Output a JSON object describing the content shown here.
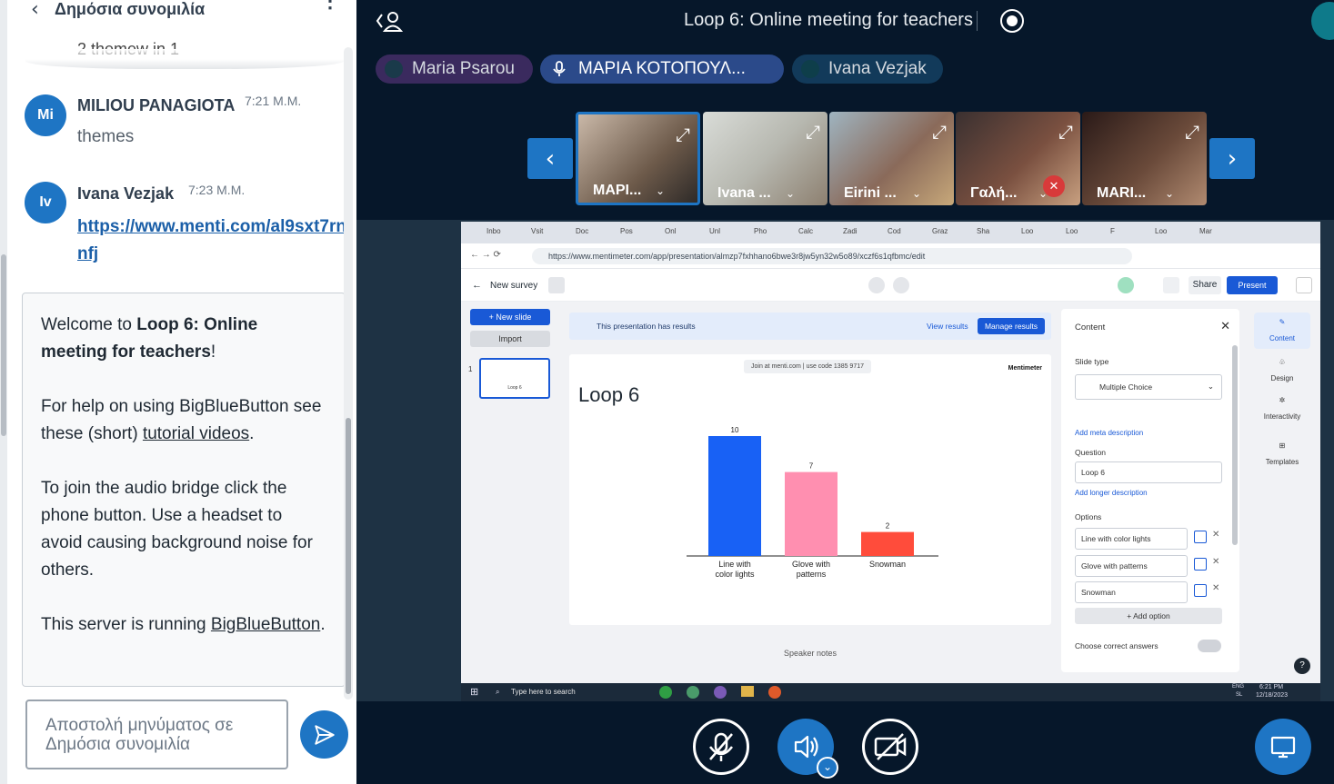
{
  "chat": {
    "header_title": "Δημόσια συνομιλία",
    "prev_text": "2 themew in 1",
    "messages": [
      {
        "initials": "Mi",
        "name": "MILIOU PANAGIOTA",
        "time": "7:21 Μ.Μ.",
        "text": "themes"
      },
      {
        "initials": "Iv",
        "name": "Ivana Vezjak",
        "time": "7:23 Μ.Μ.",
        "link": "https://www.menti.com/al9sxt7rnnfj"
      }
    ],
    "welcome": {
      "p1_pre": "Welcome to ",
      "p1_bold": "Loop 6: Online meeting for teachers",
      "p1_post": "!",
      "p2_pre": "For help on using BigBlueButton see these (short) ",
      "p2_link": "tutorial videos",
      "p2_post": ".",
      "p3": "To join the audio bridge click the phone button. Use a headset to avoid causing background noise for others.",
      "p4_pre": "This server is running ",
      "p4_link": "BigBlueButton",
      "p4_post": "."
    },
    "input_placeholder": "Αποστολή μηνύματος σε Δημόσια συνομιλία"
  },
  "meeting": {
    "title": "Loop 6: Online meeting for teachers"
  },
  "talkers": [
    {
      "name": "Maria Psarou",
      "color": "#3a2a5e"
    },
    {
      "name": "ΜΑΡΙΑ ΚΟΤΟΠΟΥΛ...",
      "color": "#2b4a8a"
    },
    {
      "name": "Ivana Vezjak",
      "color": "#123a5a"
    }
  ],
  "video_tiles": [
    {
      "name": "ΜΑΡΙ...",
      "active": true
    },
    {
      "name": "Ivana ...",
      "active": false
    },
    {
      "name": "Eirini ...",
      "active": false
    },
    {
      "name": "Γαλή...",
      "active": false,
      "muted": true
    },
    {
      "name": "MARI...",
      "active": false
    }
  ],
  "browser": {
    "url": "https://www.mentimeter.com/app/presentation/almzp7fxhhano6bwe3r8jw5yn32w5o89/xczf6s1qfbmc/edit",
    "tabs": [
      "Inbo",
      "Vsit",
      "Doc",
      "Pos",
      "Onl",
      "Unl",
      "Pho",
      "Calc",
      "Zadi",
      "Cod",
      "Graz",
      "Sha",
      "Loo",
      "Loo",
      "F",
      "Loo",
      "Mar"
    ]
  },
  "menti": {
    "back_label": "New survey",
    "share_label": "Share",
    "present_label": "Present",
    "new_slide": "+ New slide",
    "import": "Import",
    "slide_number": "1",
    "slide_thumb_label": "Loop 6",
    "banner_text": "This presentation has results",
    "view_results": "View results",
    "manage_results": "Manage results",
    "join_code": "Join at menti.com | use code  1385 9717",
    "brand": "Mentimeter",
    "slide_title": "Loop 6",
    "speaker_notes": "Speaker notes",
    "panel": {
      "title": "Content",
      "slide_type_label": "Slide type",
      "slide_type": "Multiple Choice",
      "meta_link": "Add meta description",
      "question_label": "Question",
      "question": "Loop 6",
      "longer_link": "Add longer description",
      "options_label": "Options",
      "options": [
        "Line with color lights",
        "Glove with patterns",
        "Snowman"
      ],
      "add_option": "+ Add option",
      "correct_answers": "Choose correct answers"
    },
    "tools": [
      "Content",
      "Design",
      "Interactivity",
      "Templates"
    ],
    "help": "?"
  },
  "taskbar": {
    "search": "Type here to search",
    "time": "6:21 PM",
    "date": "12/18/2023",
    "lang": "ENG",
    "region": "SL"
  },
  "chart_data": {
    "type": "bar",
    "categories": [
      "Line with color lights",
      "Glove with patterns",
      "Snowman"
    ],
    "category_lines": [
      [
        "Line with",
        "color lights"
      ],
      [
        "Glove with",
        "patterns"
      ],
      [
        "Snowman"
      ]
    ],
    "values": [
      10,
      7,
      2
    ],
    "colors": [
      "#1861f5",
      "#ff8fb0",
      "#ff4c3b"
    ],
    "title": "Loop 6",
    "ylim": [
      0,
      10
    ]
  }
}
